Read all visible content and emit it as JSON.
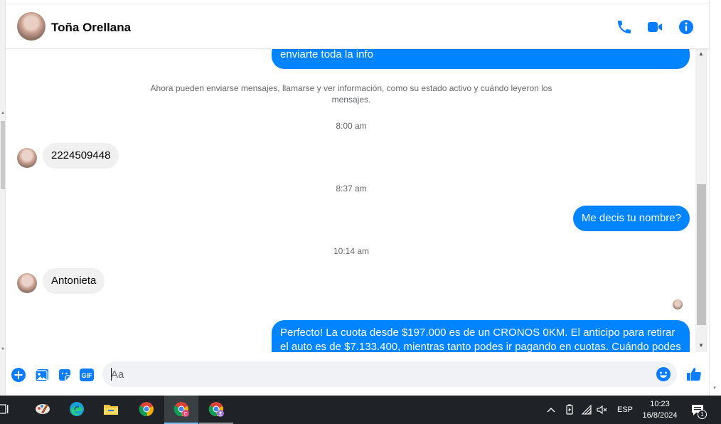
{
  "header": {
    "contact_name": "Toña Orellana"
  },
  "messages": {
    "top_partial": "enviarte toda la info",
    "system_notice": "Ahora pueden enviarse mensajes, llamarse y ver información, como su estado activo y cuándo leyeron los mensajes.",
    "items": [
      {
        "type": "timestamp",
        "text": "8:00 am"
      },
      {
        "type": "incoming",
        "text": "2224509448"
      },
      {
        "type": "timestamp",
        "text": "8:37 am"
      },
      {
        "type": "outgoing",
        "text": "Me decis tu nombre?"
      },
      {
        "type": "timestamp",
        "text": "10:14 am"
      },
      {
        "type": "incoming",
        "text": "Antonieta"
      },
      {
        "type": "outgoing",
        "text": "Perfecto! La cuota desde $197.000 es de un CRONOS 0KM. El anticipo para retirar el auto es de $7.133.400, mientras tanto podes ir pagando en cuotas. Cuándo podes"
      }
    ]
  },
  "composer": {
    "placeholder": "Aa",
    "value": "",
    "gif_label": "GIF"
  },
  "taskbar": {
    "apps": [
      "task-view-icon",
      "paint-icon",
      "edge-icon",
      "file-explorer-icon",
      "chrome-icon",
      "chrome-profile-c-icon",
      "chrome-profile-1-icon"
    ],
    "language": "ESP",
    "time": "10:23",
    "date": "16/8/2024",
    "notification_count": "1"
  },
  "colors": {
    "accent": "#0084ff",
    "icon_blue": "#0a7cff",
    "incoming_bg": "#f0f0f0",
    "taskbar_bg": "#1f2327"
  }
}
